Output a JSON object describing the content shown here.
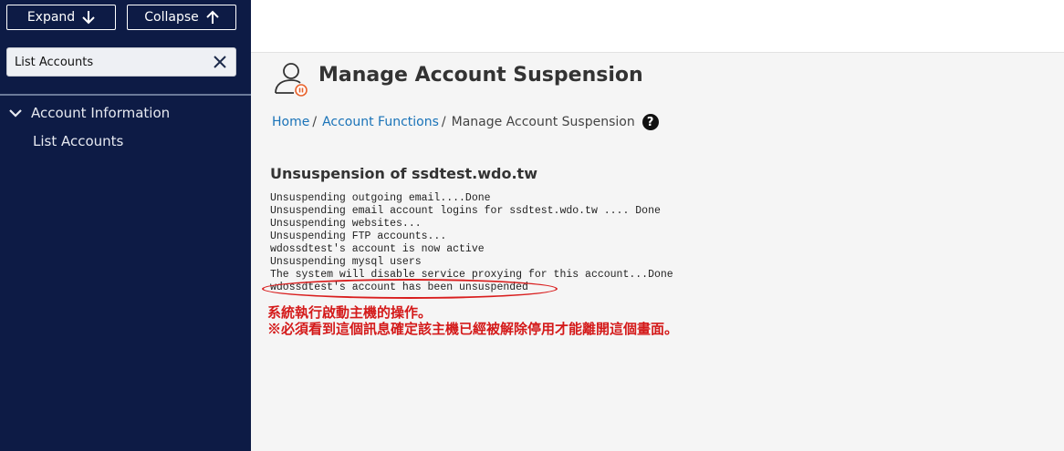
{
  "sidebar": {
    "expand_label": "Expand",
    "collapse_label": "Collapse",
    "search_value": "List Accounts",
    "section_label": "Account Information",
    "link_label": "List Accounts"
  },
  "page": {
    "title": "Manage Account Suspension",
    "breadcrumb": {
      "home": "Home",
      "sep1": "/",
      "functions": "Account Functions",
      "sep2": "/",
      "current": "Manage Account Suspension"
    },
    "help_icon": "?"
  },
  "content": {
    "heading": "Unsuspension of ssdtest.wdo.tw",
    "log": [
      "Unsuspending outgoing email....Done",
      "Unsuspending email account logins for ssdtest.wdo.tw .... Done",
      "Unsuspending websites...",
      "Unsuspending FTP accounts...",
      "wdossdtest's account is now active",
      "Unsuspending mysql users",
      "The system will disable service proxying for this account...Done",
      "wdossdtest's account has been unsuspended"
    ],
    "notes": [
      "系統執行啟動主機的操作。",
      "※必須看到這個訊息確定該主機已經被解除停用才能離開這個畫面。"
    ]
  },
  "colors": {
    "sidebar_bg": "#0d1b45",
    "link": "#1a73b8",
    "note_red": "#d41a1a"
  }
}
